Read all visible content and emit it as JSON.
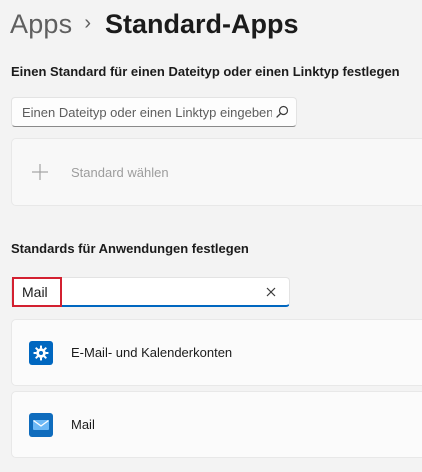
{
  "breadcrumb": {
    "parent": "Apps",
    "separator": "›",
    "current": "Standard-Apps"
  },
  "filetype_section": {
    "title": "Einen Standard für einen Dateityp oder einen Linktyp festlegen",
    "search_placeholder": "Einen Dateityp oder einen Linktyp eingeben",
    "search_icon": "search-icon",
    "choose_default_label": "Standard wählen",
    "choose_default_icon": "plus-icon"
  },
  "apps_section": {
    "title": "Standards für Anwendungen festlegen",
    "search_value": "Mail",
    "clear_icon": "close-icon",
    "results": [
      {
        "label": "E-Mail- und Kalenderkonten",
        "icon": "gear-icon",
        "icon_color": "#0067c0"
      },
      {
        "label": "Mail",
        "icon": "mail-icon",
        "icon_color": "#0f6cbd"
      }
    ]
  },
  "colors": {
    "accent": "#0067c0",
    "highlight_border": "#d32030",
    "background": "#f3f3f3"
  }
}
